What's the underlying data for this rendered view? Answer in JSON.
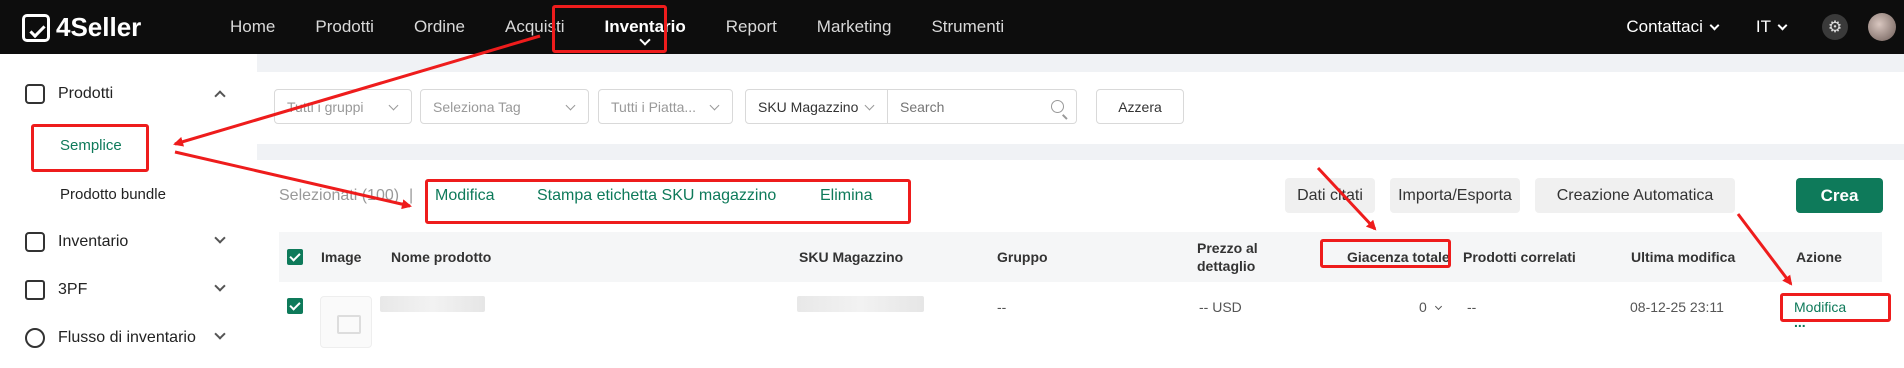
{
  "app": {
    "brand": "4Seller"
  },
  "nav": {
    "items": [
      {
        "label": "Home"
      },
      {
        "label": "Prodotti"
      },
      {
        "label": "Ordine"
      },
      {
        "label": "Acquisti"
      },
      {
        "label": "Inventario"
      },
      {
        "label": "Report"
      },
      {
        "label": "Marketing"
      },
      {
        "label": "Strumenti"
      }
    ],
    "active": "Inventario",
    "contact": "Contattaci",
    "language": "IT"
  },
  "sidebar": {
    "sections": [
      {
        "label": "Prodotti",
        "expanded": true,
        "icon": "box-icon"
      },
      {
        "label": "Inventario",
        "expanded": false,
        "icon": "inventory-icon"
      },
      {
        "label": "3PF",
        "expanded": false,
        "icon": "cube-icon"
      },
      {
        "label": "Flusso di inventario",
        "expanded": false,
        "icon": "flow-icon"
      }
    ],
    "sub_items": [
      {
        "label": "Semplice",
        "active": true
      },
      {
        "label": "Prodotto bundle",
        "active": false
      }
    ]
  },
  "filters": {
    "group": "Tutti i gruppi",
    "tag": "Seleziona Tag",
    "platform": "Tutti i Piatta...",
    "sku_type": "SKU Magazzino",
    "search_placeholder": "Search",
    "reset": "Azzera"
  },
  "toolbar": {
    "selected": "Selezionati (100)",
    "separator": "|",
    "edit": "Modifica",
    "print_label": "Stampa etichetta SKU magazzino",
    "delete": "Elimina",
    "data_btn": "Dati citati",
    "import_export": "Importa/Esporta",
    "auto_create": "Creazione Automatica",
    "create": "Crea"
  },
  "table": {
    "headers": {
      "image": "Image",
      "name": "Nome prodotto",
      "sku": "SKU Magazzino",
      "group": "Gruppo",
      "price_line1": "Prezzo al",
      "price_line2": "dettaglio",
      "stock": "Giacenza totale",
      "related": "Prodotti correlati",
      "modified": "Ultima modifica",
      "action": "Azione"
    },
    "rows": [
      {
        "group": "--",
        "price": "-- USD",
        "stock": "0",
        "related": "--",
        "modified": "08-12-25 23:11",
        "action_edit": "Modifica",
        "action_more": "..."
      }
    ]
  },
  "colors": {
    "accent": "#0e7a5a",
    "topbar": "#0d0d0d",
    "annotation": "#ee1c1c"
  }
}
